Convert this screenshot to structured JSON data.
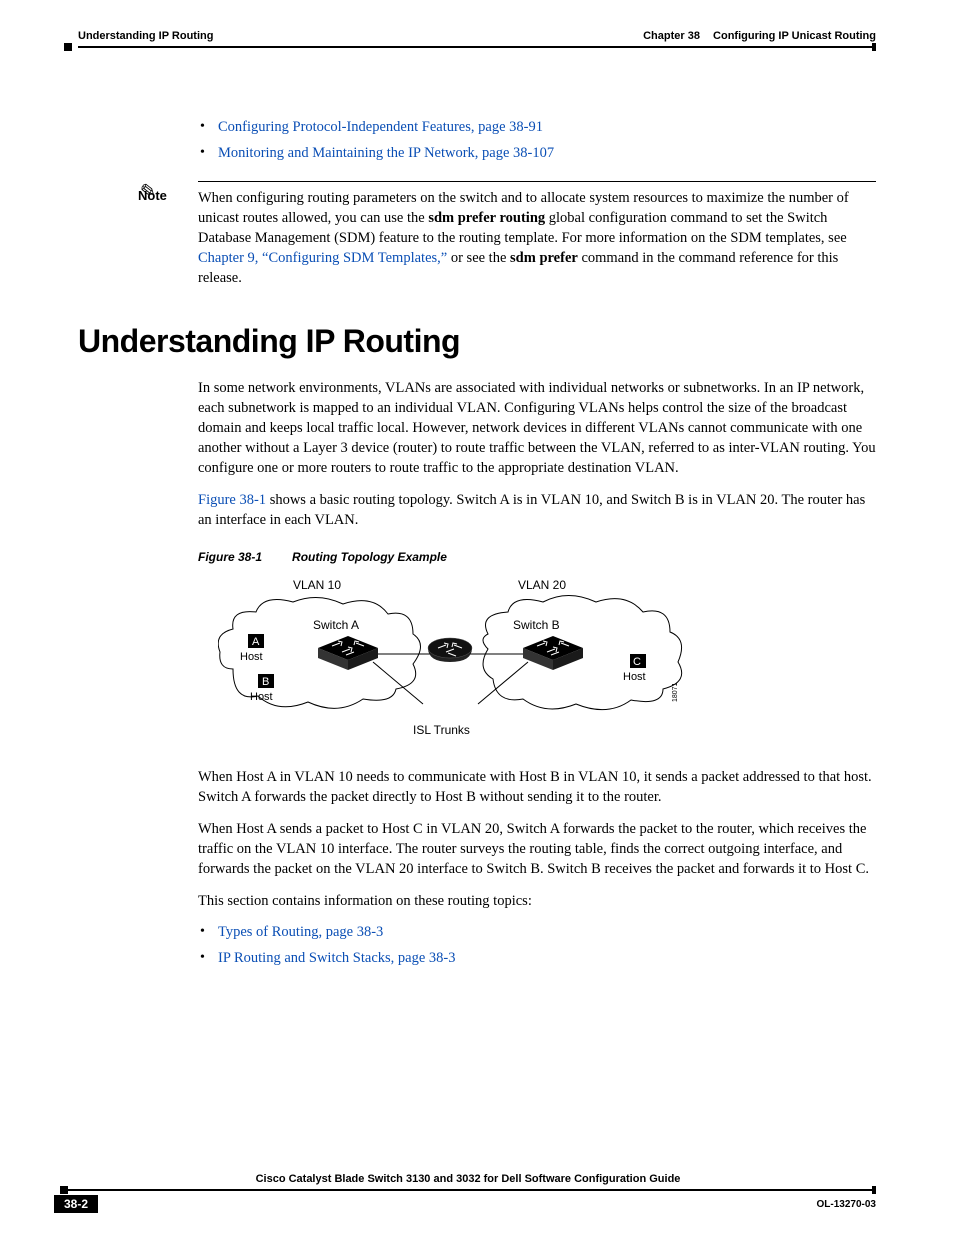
{
  "header": {
    "section": "Understanding IP Routing",
    "chapter": "Chapter 38",
    "chapterTitle": "Configuring IP Unicast Routing"
  },
  "bulletsTop": [
    "Configuring Protocol-Independent Features, page 38-91",
    "Monitoring and Maintaining the IP Network, page 38-107"
  ],
  "note": {
    "label": "Note",
    "pre": "When configuring routing parameters on the switch and to allocate system resources to maximize the number of unicast routes allowed, you can use the ",
    "bold1": "sdm prefer routing",
    "mid1": " global configuration command to set the Switch Database Management (SDM) feature to the routing template. For more information on the SDM templates, see ",
    "xref": "Chapter 9, “Configuring SDM Templates,”",
    "mid2": " or see the ",
    "bold2": "sdm prefer",
    "post": " command in the command reference for this release."
  },
  "h1": "Understanding IP Routing",
  "para1": "In some network environments, VLANs are associated with individual networks or subnetworks. In an IP network, each subnetwork is mapped to an individual VLAN. Configuring VLANs helps control the size of the broadcast domain and keeps local traffic local. However, network devices in different VLANs cannot communicate with one another without a Layer 3 device (router) to route traffic between the VLAN, referred to as inter-VLAN routing. You configure one or more routers to route traffic to the appropriate destination VLAN.",
  "para2_pre": "Figure 38-1",
  "para2_rest": " shows a basic routing topology. Switch A is in VLAN 10, and Switch B is in VLAN 20. The router has an interface in each VLAN.",
  "figure": {
    "label": "Figure 38-1",
    "caption": "Routing Topology Example",
    "vlan10": "VLAN 10",
    "vlan20": "VLAN 20",
    "switchA": "Switch A",
    "switchB": "Switch B",
    "hostA": "Host",
    "hostB": "Host",
    "hostC": "Host",
    "trunks": "ISL Trunks",
    "id": "18071",
    "tagA": "A",
    "tagB": "B",
    "tagC": "C"
  },
  "para3": "When Host A in VLAN 10 needs to communicate with Host B in VLAN 10, it sends a packet addressed to that host. Switch A forwards the packet directly to Host B without sending it to the router.",
  "para4": "When Host A sends a packet to Host C in VLAN 20, Switch A forwards the packet to the router, which receives the traffic on the VLAN 10 interface. The router surveys the routing table, finds the correct outgoing interface, and forwards the packet on the VLAN 20 interface to Switch B. Switch B receives the packet and forwards it to Host C.",
  "para5": "This section contains information on these routing topics:",
  "bulletsBottom": [
    "Types of Routing, page 38-3",
    "IP Routing and Switch Stacks, page 38-3"
  ],
  "footer": {
    "guide": "Cisco Catalyst Blade Switch 3130 and 3032 for Dell Software Configuration Guide",
    "page": "38-2",
    "docid": "OL-13270-03"
  }
}
